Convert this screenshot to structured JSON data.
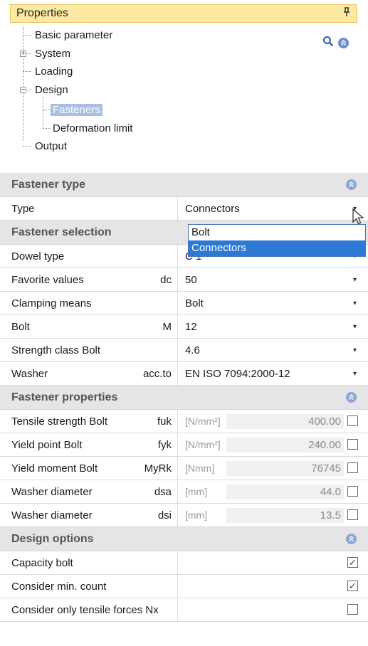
{
  "panel": {
    "title": "Properties",
    "pin_glyph": "ᵽ"
  },
  "tree": {
    "items": [
      {
        "label": "Basic parameter"
      },
      {
        "label": "System",
        "expander": "+"
      },
      {
        "label": "Loading"
      },
      {
        "label": "Design",
        "expander": "−"
      },
      {
        "label": "Fasteners",
        "selected": true
      },
      {
        "label": "Deformation limit"
      },
      {
        "label": "Output"
      }
    ],
    "tools": {
      "search_icon": "search-icon",
      "collapse_icon": "collapse-all-icon"
    }
  },
  "sections": {
    "fastener_type": "Fastener type",
    "fastener_selection": "Fastener selection",
    "fastener_properties": "Fastener properties",
    "design_options": "Design options"
  },
  "type_row": {
    "name": "Type",
    "value": "Connectors"
  },
  "dropdown": {
    "options": [
      "Bolt",
      "Connectors"
    ],
    "selected": "Connectors"
  },
  "selection_rows": [
    {
      "name": "Dowel type",
      "symbol": "",
      "value": "C 1"
    },
    {
      "name": "Favorite values",
      "symbol": "dc",
      "value": "50"
    },
    {
      "name": "Clamping means",
      "symbol": "",
      "value": "Bolt"
    },
    {
      "name": "Bolt",
      "symbol": "M",
      "value": "12"
    },
    {
      "name": "Strength class Bolt",
      "symbol": "",
      "value": "4.6"
    },
    {
      "name": "Washer",
      "symbol": "acc.to",
      "value": "EN ISO 7094:2000-12"
    }
  ],
  "property_rows": [
    {
      "name": "Tensile strength Bolt",
      "symbol": "fuk",
      "unit": "[N/mm²]",
      "value": "400.00"
    },
    {
      "name": "Yield point Bolt",
      "symbol": "fyk",
      "unit": "[N/mm²]",
      "value": "240.00"
    },
    {
      "name": "Yield moment Bolt",
      "symbol": "MyRk",
      "unit": "[Nmm]",
      "value": "76745"
    },
    {
      "name": "Washer diameter",
      "symbol": "dsa",
      "unit": "[mm]",
      "value": "44.0"
    },
    {
      "name": "Washer diameter",
      "symbol": "dsi",
      "unit": "[mm]",
      "value": "13.5"
    }
  ],
  "option_rows": [
    {
      "name": "Capacity bolt",
      "checked": true
    },
    {
      "name": "Consider min. count",
      "checked": true
    },
    {
      "name": "Consider only tensile forces Nx",
      "checked": false
    }
  ],
  "colors": {
    "title_bg": "#fde9a1",
    "selected_tree": "#a9bfe2",
    "dropdown_selected": "#2c7ad6"
  }
}
